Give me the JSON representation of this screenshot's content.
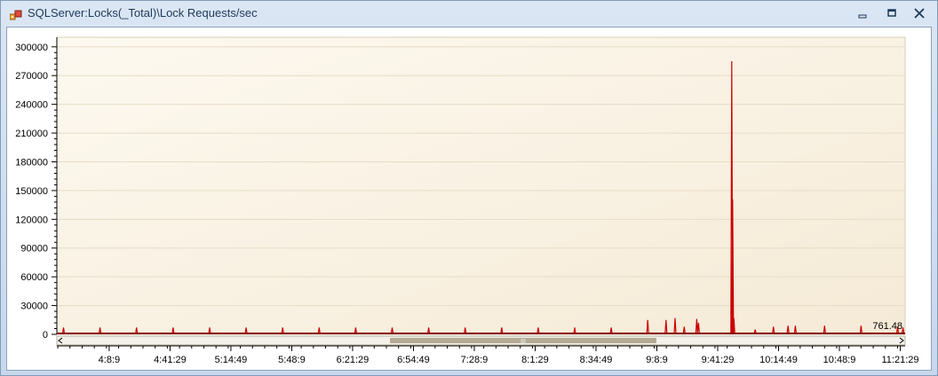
{
  "window": {
    "title": "SQLServer:Locks(_Total)\\Lock Requests/sec",
    "icons": {
      "app": "chart-app-icon",
      "minimize": "minimize-icon",
      "restore": "restore-icon",
      "close": "close-icon"
    }
  },
  "chart_data": {
    "type": "line",
    "title": "",
    "xlabel": "",
    "ylabel": "",
    "ylim": [
      0,
      310000
    ],
    "yticks": [
      0,
      30000,
      60000,
      90000,
      120000,
      150000,
      180000,
      210000,
      240000,
      270000,
      300000
    ],
    "ytick_labels": [
      "0",
      "30000",
      "60000",
      "90000",
      "120000",
      "150000",
      "180000",
      "210000",
      "240000",
      "270000",
      "300000"
    ],
    "xticks": [
      "4:8:9",
      "4:41:29",
      "5:14:49",
      "5:48:9",
      "6:21:29",
      "6:54:49",
      "7:28:9",
      "8:1:29",
      "8:34:49",
      "9:8:9",
      "9:41:29",
      "10:14:49",
      "10:48:9",
      "11:21:29"
    ],
    "x_range": [
      "3:39:29",
      "11:24:9"
    ],
    "grid": true,
    "last_value_label": "761.48",
    "colors": {
      "series": "#cc0000",
      "plot_bg_start": "#fdf9f0",
      "plot_bg_end": "#f5ead6",
      "grid": "#e6dcc6",
      "scrollbar_thumb": "#b3aa95"
    },
    "series": [
      {
        "values_description": "baseline near 0 with periodic spikes",
        "points": [
          [
            "3:43:9",
            7000
          ],
          [
            "4:3:9",
            7000
          ],
          [
            "4:23:9",
            7000
          ],
          [
            "4:43:9",
            7000
          ],
          [
            "5:3:9",
            7000
          ],
          [
            "5:23:9",
            7000
          ],
          [
            "5:43:9",
            7000
          ],
          [
            "6:3:9",
            7000
          ],
          [
            "6:23:9",
            7000
          ],
          [
            "6:43:9",
            7000
          ],
          [
            "7:3:9",
            7000
          ],
          [
            "7:23:9",
            7000
          ],
          [
            "7:43:9",
            7000
          ],
          [
            "8:3:9",
            7000
          ],
          [
            "8:23:9",
            7000
          ],
          [
            "8:43:9",
            7000
          ],
          [
            "9:3:9",
            15000
          ],
          [
            "9:13:9",
            15000
          ],
          [
            "9:18:9",
            17000
          ],
          [
            "9:23:9",
            8000
          ],
          [
            "9:30:0",
            16000
          ],
          [
            "9:31:0",
            12000
          ],
          [
            "9:49:9",
            285000
          ],
          [
            "9:49:40",
            141000
          ],
          [
            "9:50:20",
            17000
          ],
          [
            "10:2:0",
            5000
          ],
          [
            "10:12:0",
            8000
          ],
          [
            "10:20:0",
            9000
          ],
          [
            "10:24:0",
            9000
          ],
          [
            "10:40:0",
            9000
          ],
          [
            "11:0:0",
            9000
          ],
          [
            "11:20:0",
            8000
          ],
          [
            "11:23:0",
            7000
          ]
        ]
      }
    ]
  },
  "scrollbar": {
    "left_arrow": "scroll-left-icon",
    "right_arrow": "scroll-right-icon",
    "thumb_grip": "III"
  }
}
